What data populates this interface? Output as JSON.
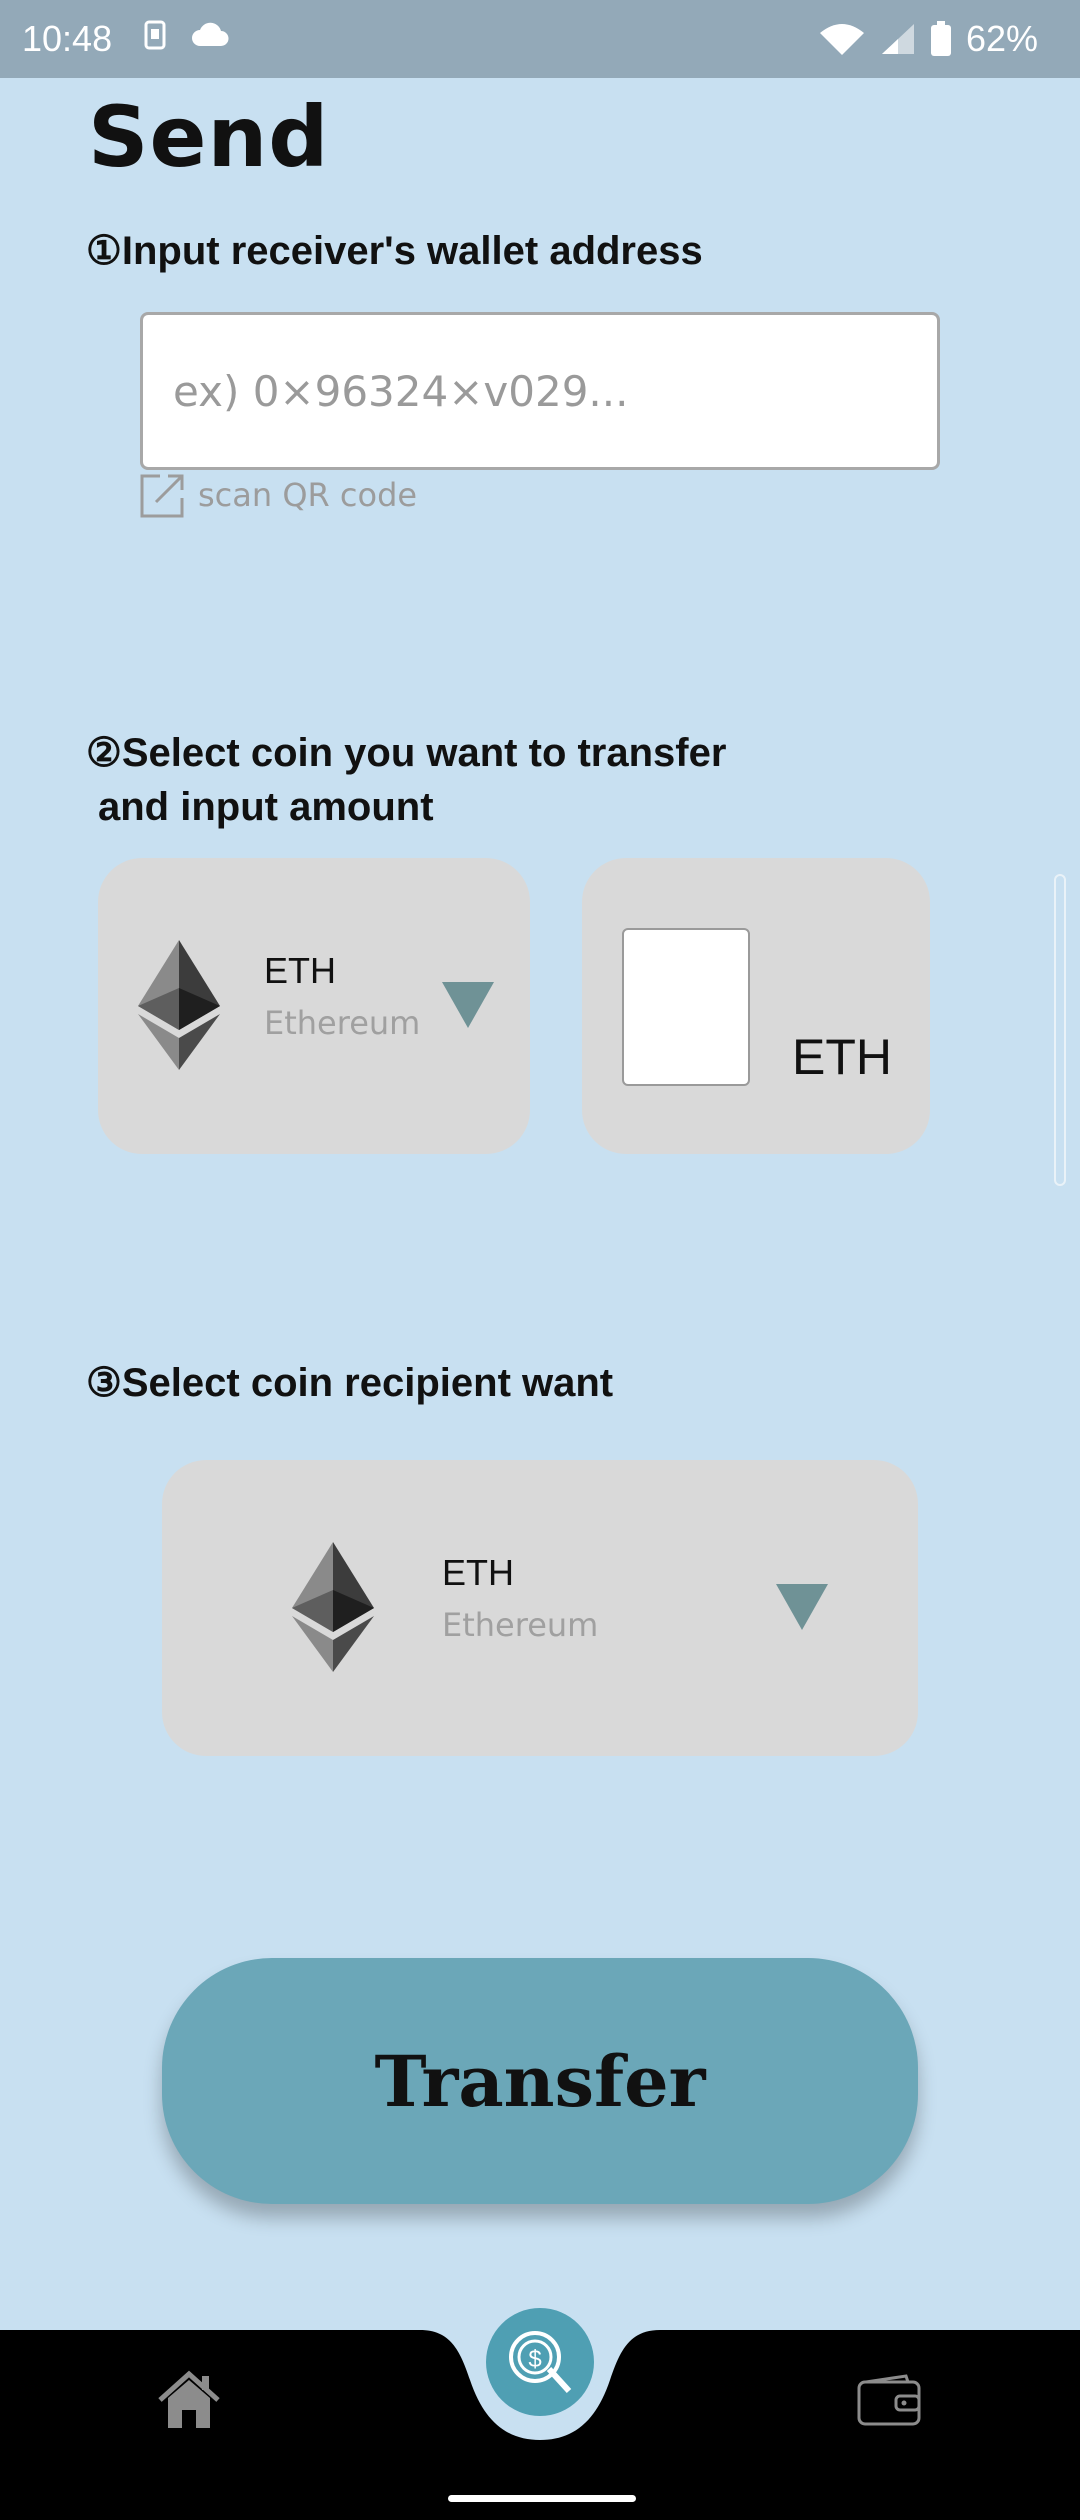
{
  "status_bar": {
    "time": "10:48",
    "battery_percent": "62%",
    "icons": [
      "notification-sim-icon",
      "cloud-icon",
      "wifi-icon",
      "signal-icon",
      "battery-icon"
    ]
  },
  "page": {
    "title": "Send"
  },
  "step1": {
    "heading": "①Input receiver's wallet address",
    "address_placeholder": "ex) 0×96324×v029...",
    "address_value": "",
    "scan_label": "scan QR code"
  },
  "step2": {
    "heading_line1": "②Select coin you want to transfer",
    "heading_line2": "and input amount",
    "coin_symbol": "ETH",
    "coin_name": "Ethereum",
    "amount_value": "",
    "amount_unit": "ETH"
  },
  "step3": {
    "heading": "③Select coin recipient want",
    "coin_symbol": "ETH",
    "coin_name": "Ethereum"
  },
  "actions": {
    "transfer_label": "Transfer"
  },
  "bottom_nav": {
    "items": [
      "home-icon",
      "send-coin-icon",
      "wallet-icon"
    ],
    "active": "send-coin-icon"
  },
  "colors": {
    "background": "#c8e0f1",
    "status_bar": "#93a9b8",
    "card": "#d9d9d9",
    "accent": "#6ba7b8",
    "dropdown_arrow": "#6f9296",
    "nav_bar": "#000000",
    "nav_active": "#4f9fb3"
  }
}
